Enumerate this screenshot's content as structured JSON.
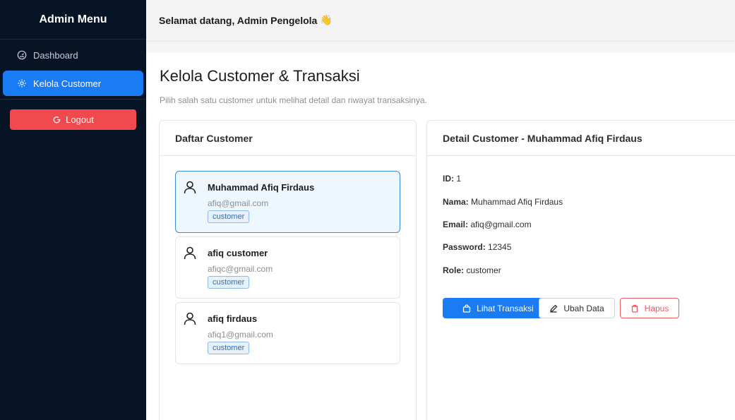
{
  "sidebar": {
    "title": "Admin Menu",
    "items": [
      {
        "label": "Dashboard",
        "icon": "dashboard-gauge-icon"
      },
      {
        "label": "Kelola Customer",
        "icon": "gear-icon"
      }
    ],
    "logout_label": "Logout"
  },
  "topbar": {
    "welcome": "Selamat datang, Admin Pengelola",
    "emoji": "👋"
  },
  "main": {
    "title": "Kelola Customer & Transaksi",
    "subtitle": "Pilih salah satu customer untuk melihat detail dan riwayat transaksinya."
  },
  "customer_list": {
    "header": "Daftar Customer",
    "items": [
      {
        "name": "Muhammad Afiq Firdaus",
        "email": "afiq@gmail.com",
        "role": "customer",
        "selected": true
      },
      {
        "name": "afiq customer",
        "email": "afiqc@gmail.com",
        "role": "customer",
        "selected": false
      },
      {
        "name": "afiq firdaus",
        "email": "afiq1@gmail.com",
        "role": "customer",
        "selected": false
      }
    ]
  },
  "detail": {
    "header": "Detail Customer - Muhammad Afiq Firdaus",
    "fields": [
      {
        "label": "ID:",
        "value": "1"
      },
      {
        "label": "Nama:",
        "value": "Muhammad Afiq Firdaus"
      },
      {
        "label": "Email:",
        "value": "afiq@gmail.com"
      },
      {
        "label": "Password:",
        "value": "12345"
      },
      {
        "label": "Role:",
        "value": "customer"
      }
    ],
    "buttons": {
      "view_transactions": "Lihat Transaksi",
      "edit": "Ubah Data",
      "delete": "Hapus"
    }
  },
  "colors": {
    "sidebar_bg": "#061426",
    "primary": "#1a7cf5",
    "danger": "#f04a4f"
  }
}
